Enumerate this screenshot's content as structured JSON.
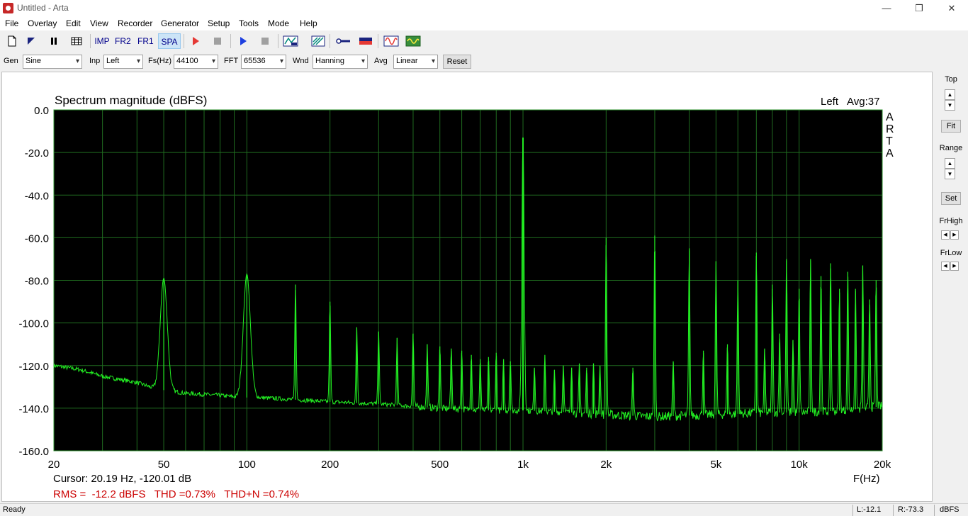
{
  "window": {
    "title": "Untitled - Arta",
    "minimize": "—",
    "maximize": "❐",
    "close": "✕"
  },
  "menu": [
    "File",
    "Overlay",
    "Edit",
    "View",
    "Recorder",
    "Generator",
    "Setup",
    "Tools",
    "Mode",
    "Help"
  ],
  "toolbar": {
    "imp": "IMP",
    "fr2": "FR2",
    "fr1": "FR1",
    "spa": "SPA"
  },
  "controls": {
    "gen_label": "Gen",
    "gen_value": "Sine",
    "inp_label": "Inp",
    "inp_value": "Left",
    "fs_label": "Fs(Hz)",
    "fs_value": "44100",
    "fft_label": "FFT",
    "fft_value": "65536",
    "wnd_label": "Wnd",
    "wnd_value": "Hanning",
    "avg_label": "Avg",
    "avg_value": "Linear",
    "reset": "Reset"
  },
  "right_panel": {
    "top": "Top",
    "fit": "Fit",
    "range": "Range",
    "set": "Set",
    "frhigh": "FrHigh",
    "frlow": "FrLow"
  },
  "plot": {
    "cursor": "Cursor: 20.19 Hz, -120.01 dB",
    "measure": "RMS =  -12.2 dBFS   THD =0.73%   THD+N =0.74%",
    "arta": [
      "A",
      "R",
      "T",
      "A"
    ],
    "trace_color": "#22ee22",
    "grid_color": "#1f6b1f",
    "measure_color": "#cc0000"
  },
  "chart_data": {
    "type": "line",
    "title": "Spectrum magnitude (dBFS)",
    "channel_label": "Left",
    "avg_label": "Avg:37",
    "xlabel": "F(Hz)",
    "ylabel": "",
    "xscale": "log",
    "xlim": [
      20,
      20000
    ],
    "ylim": [
      -160,
      0
    ],
    "xticks": [
      {
        "v": 20,
        "label": "20"
      },
      {
        "v": 50,
        "label": "50"
      },
      {
        "v": 100,
        "label": "100"
      },
      {
        "v": 200,
        "label": "200"
      },
      {
        "v": 500,
        "label": "500"
      },
      {
        "v": 1000,
        "label": "1k"
      },
      {
        "v": 2000,
        "label": "2k"
      },
      {
        "v": 5000,
        "label": "5k"
      },
      {
        "v": 10000,
        "label": "10k"
      },
      {
        "v": 20000,
        "label": "20k"
      }
    ],
    "yticks": [
      {
        "v": 0,
        "label": "0.0"
      },
      {
        "v": -20,
        "label": "-20.0"
      },
      {
        "v": -40,
        "label": "-40.0"
      },
      {
        "v": -60,
        "label": "-60.0"
      },
      {
        "v": -80,
        "label": "-80.0"
      },
      {
        "v": -100,
        "label": "-100.0"
      },
      {
        "v": -120,
        "label": "-120.0"
      },
      {
        "v": -140,
        "label": "-140.0"
      },
      {
        "v": -160,
        "label": "-160.0"
      }
    ],
    "grid": true,
    "noise_floor": [
      [
        20,
        -120
      ],
      [
        25,
        -122
      ],
      [
        30,
        -125
      ],
      [
        40,
        -128
      ],
      [
        47,
        -131
      ],
      [
        60,
        -133
      ],
      [
        80,
        -134
      ],
      [
        95,
        -135
      ],
      [
        110,
        -135
      ],
      [
        150,
        -136
      ],
      [
        200,
        -137
      ],
      [
        300,
        -138
      ],
      [
        500,
        -140
      ],
      [
        700,
        -141
      ],
      [
        1000,
        -141
      ],
      [
        1500,
        -142
      ],
      [
        2000,
        -143
      ],
      [
        3000,
        -144
      ],
      [
        5000,
        -143
      ],
      [
        8000,
        -142
      ],
      [
        10000,
        -142
      ],
      [
        15000,
        -141
      ],
      [
        20000,
        -139
      ]
    ],
    "peaks": [
      [
        50,
        -79
      ],
      [
        100,
        -77
      ],
      [
        150,
        -82
      ],
      [
        200,
        -90
      ],
      [
        250,
        -102
      ],
      [
        300,
        -104
      ],
      [
        350,
        -107
      ],
      [
        400,
        -105
      ],
      [
        450,
        -110
      ],
      [
        500,
        -111
      ],
      [
        550,
        -112
      ],
      [
        600,
        -113
      ],
      [
        650,
        -115
      ],
      [
        700,
        -117
      ],
      [
        750,
        -116
      ],
      [
        800,
        -114
      ],
      [
        850,
        -117
      ],
      [
        900,
        -118
      ],
      [
        1000,
        -13
      ],
      [
        1100,
        -121
      ],
      [
        1200,
        -115
      ],
      [
        1300,
        -122
      ],
      [
        1400,
        -120
      ],
      [
        1500,
        -121
      ],
      [
        1600,
        -119
      ],
      [
        1700,
        -121
      ],
      [
        1800,
        -119
      ],
      [
        1900,
        -120
      ],
      [
        2000,
        -60
      ],
      [
        2500,
        -121
      ],
      [
        3000,
        -59
      ],
      [
        3500,
        -118
      ],
      [
        4000,
        -65
      ],
      [
        4500,
        -113
      ],
      [
        5000,
        -71
      ],
      [
        5500,
        -110
      ],
      [
        6000,
        -80
      ],
      [
        7000,
        -67
      ],
      [
        7500,
        -112
      ],
      [
        8000,
        -82
      ],
      [
        8500,
        -105
      ],
      [
        9000,
        -70
      ],
      [
        9500,
        -108
      ],
      [
        10000,
        -84
      ],
      [
        11000,
        -70
      ],
      [
        12000,
        -78
      ],
      [
        13000,
        -72
      ],
      [
        14000,
        -84
      ],
      [
        15000,
        -76
      ],
      [
        16000,
        -84
      ],
      [
        17000,
        -73
      ],
      [
        18000,
        -89
      ],
      [
        19000,
        -80
      ]
    ]
  },
  "status": {
    "ready": "Ready",
    "l": "L:-12.1",
    "r": "R:-73.3",
    "unit": "dBFS"
  }
}
